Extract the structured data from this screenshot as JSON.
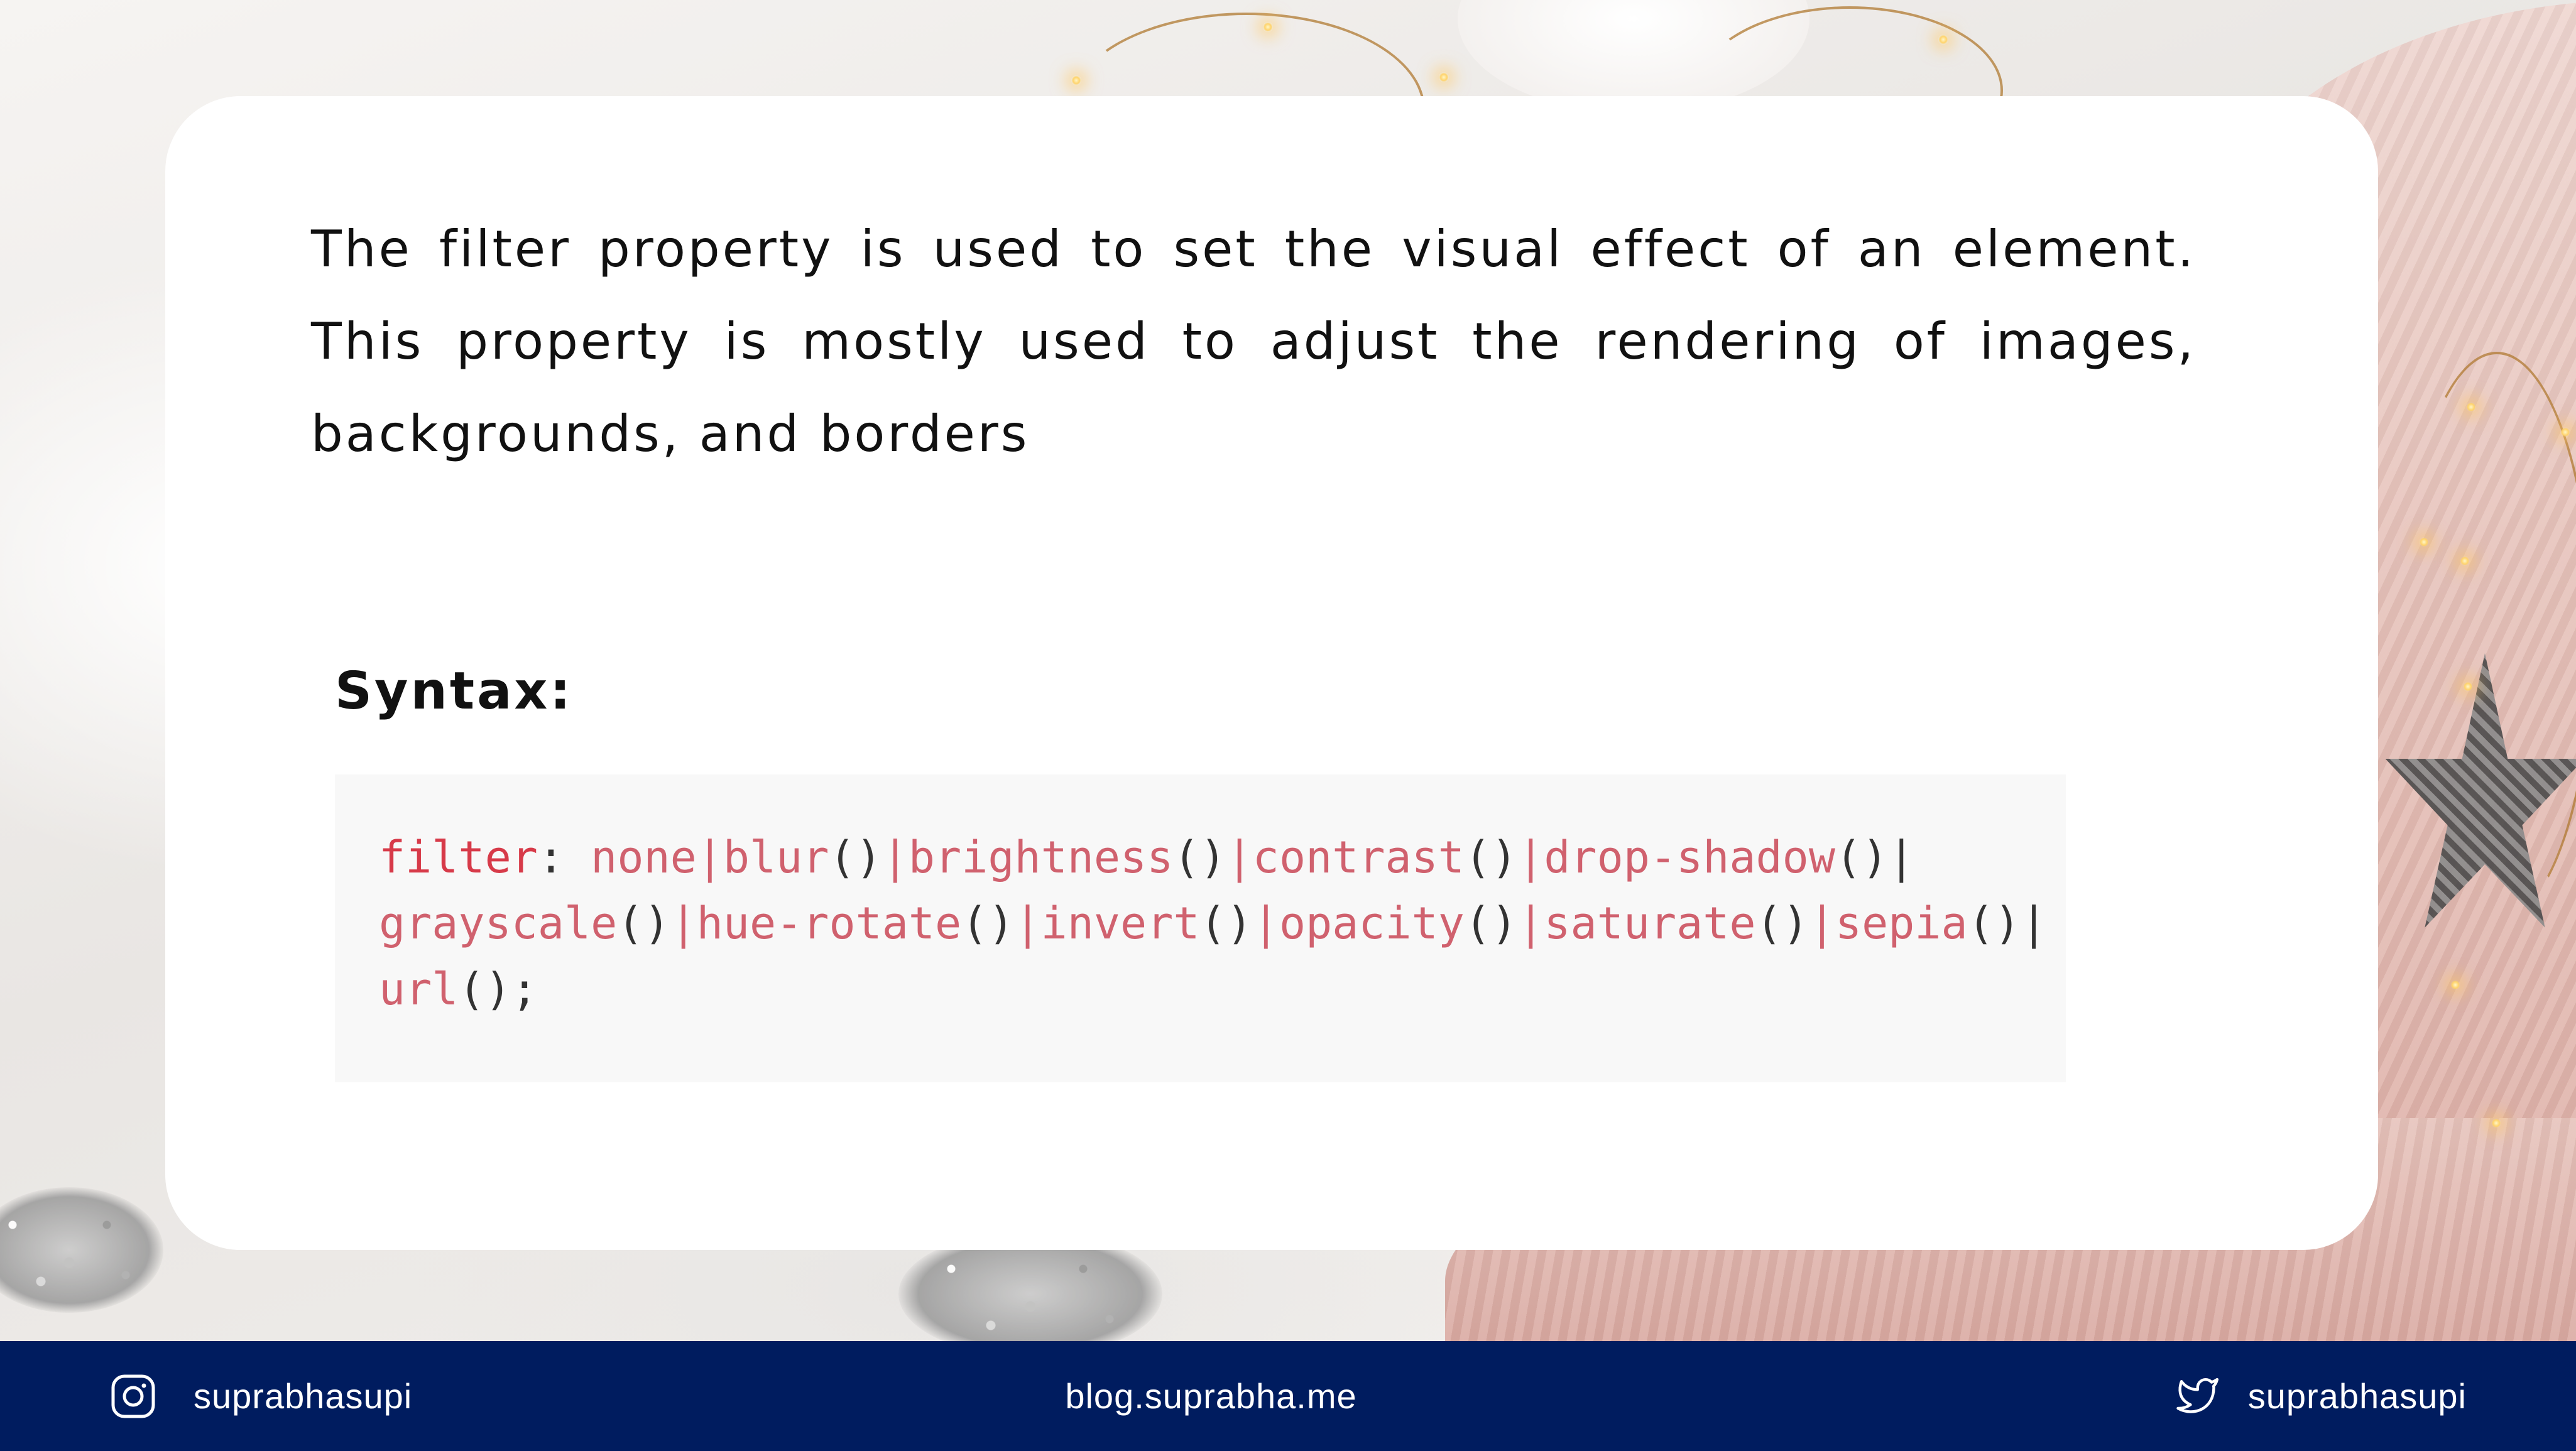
{
  "content": {
    "description": "The filter property is used to set the visual effect of an element. This property is mostly used to adjust the rendering of images, backgrounds, and borders",
    "syntax_heading": "Syntax:"
  },
  "code": {
    "lines": [
      [
        {
          "t": "filter",
          "k": "prop"
        },
        {
          "t": ": ",
          "k": "punc"
        },
        {
          "t": "none|blur",
          "k": "val"
        },
        {
          "t": "()",
          "k": "punc"
        },
        {
          "t": "|brightness",
          "k": "val"
        },
        {
          "t": "()",
          "k": "punc"
        },
        {
          "t": "|contrast",
          "k": "val"
        },
        {
          "t": "()",
          "k": "punc"
        },
        {
          "t": "|drop-shadow",
          "k": "val"
        },
        {
          "t": "()|",
          "k": "punc"
        }
      ],
      [
        {
          "t": "grayscale",
          "k": "val"
        },
        {
          "t": "()",
          "k": "punc"
        },
        {
          "t": "|hue-rotate",
          "k": "val"
        },
        {
          "t": "()",
          "k": "punc"
        },
        {
          "t": "|invert",
          "k": "val"
        },
        {
          "t": "()",
          "k": "punc"
        },
        {
          "t": "|opacity",
          "k": "val"
        },
        {
          "t": "()",
          "k": "punc"
        },
        {
          "t": "|saturate",
          "k": "val"
        },
        {
          "t": "()",
          "k": "punc"
        },
        {
          "t": "|sepia",
          "k": "val"
        },
        {
          "t": "()|",
          "k": "punc"
        }
      ],
      [
        {
          "t": "url",
          "k": "val"
        },
        {
          "t": "();",
          "k": "punc"
        }
      ]
    ]
  },
  "footer": {
    "instagram_handle": "suprabhasupi",
    "blog_url": "blog.suprabha.me",
    "twitter_handle": "suprabhasupi",
    "background_color": "#001c5f",
    "left_icon": "instagram-icon",
    "right_icon": "twitter-icon"
  }
}
